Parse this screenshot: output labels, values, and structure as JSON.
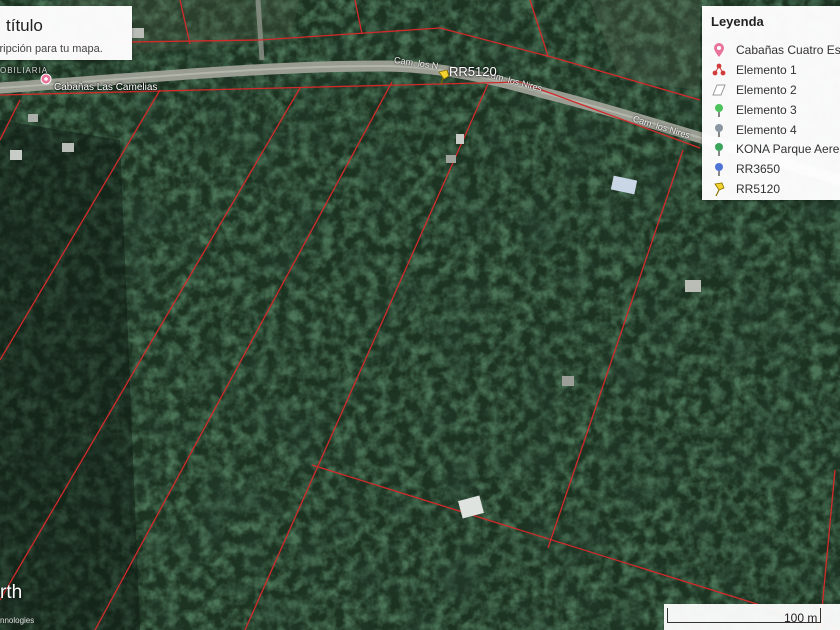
{
  "map_panel": {
    "title": "título",
    "description": "cripción para tu mapa."
  },
  "legend": {
    "title": "Leyenda",
    "items": [
      {
        "label": "Cabañas Cuatro Es",
        "icon": "pink-pin-icon",
        "color": "#e8749b"
      },
      {
        "label": "Elemento 1",
        "icon": "red-dots-icon",
        "color": "#d23b3b"
      },
      {
        "label": "Elemento 2",
        "icon": "white-polygon-icon",
        "color": "#ffffff"
      },
      {
        "label": "Elemento 3",
        "icon": "green-pin-icon",
        "color": "#4cc35a"
      },
      {
        "label": "Elemento 4",
        "icon": "gray-pin-icon",
        "color": "#8a97a3"
      },
      {
        "label": "KONA Parque Aereo",
        "icon": "green-pin-icon",
        "color": "#3aa55b"
      },
      {
        "label": "RR3650",
        "icon": "blue-pin-icon",
        "color": "#4f74d6"
      },
      {
        "label": "RR5120",
        "icon": "yellow-pushpin-icon",
        "color": "#f2d22e"
      }
    ]
  },
  "map_labels": {
    "road_1": "Cam. los N",
    "road_2": "Cam. los Nires",
    "road_3": "Cam. los Nires",
    "place_1": "Cabañas Las Camelias",
    "place_2": "OBILIARIA",
    "marker_rr5120": "RR5120"
  },
  "footer": {
    "brand": "rth",
    "credit": "nnologies",
    "scale_label": "100 m"
  },
  "colors": {
    "parcel_line": "#d32a2a",
    "road": "#a9aba2",
    "forest": "#1d3322"
  }
}
